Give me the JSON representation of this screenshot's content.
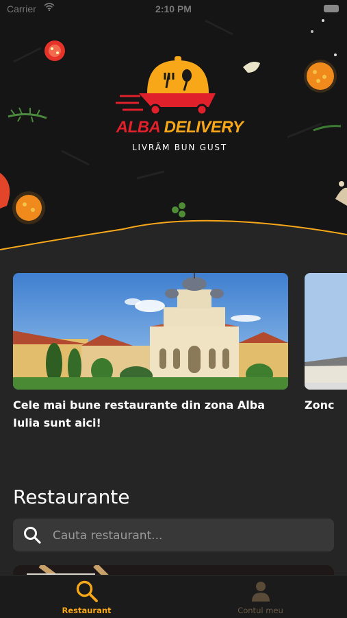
{
  "status_bar": {
    "carrier": "Carrier",
    "time": "2:10 PM"
  },
  "brand": {
    "name_part1": "ALBA",
    "name_part2": "DELIVERY",
    "tagline": "LIVRĂM BUN GUST"
  },
  "carousel": {
    "cards": [
      {
        "title": "Cele mai bune restaurante din zona Alba Iulia sunt aici!"
      },
      {
        "title": "Zonc"
      }
    ]
  },
  "restaurants": {
    "heading": "Restaurante",
    "search_placeholder": "Cauta restaurant..."
  },
  "tabbar": {
    "tabs": [
      {
        "label": "Restaurant",
        "icon": "search-icon",
        "active": true
      },
      {
        "label": "Contul meu",
        "icon": "user-icon",
        "active": false
      }
    ]
  },
  "colors": {
    "accent": "#f7a718",
    "brand_red": "#e0202a",
    "background": "#252525",
    "hero_background": "#121212"
  }
}
